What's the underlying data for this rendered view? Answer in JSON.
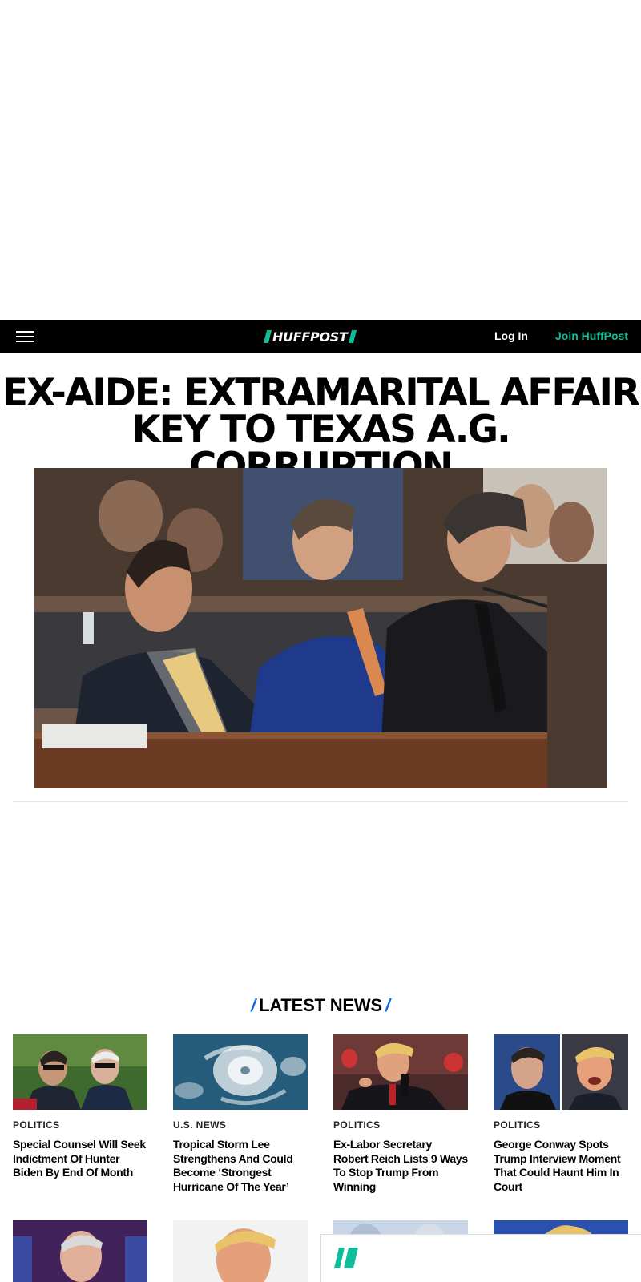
{
  "nav": {
    "logo_text": "HUFFPOST",
    "login_label": "Log In",
    "join_label": "Join HuffPost",
    "accent_color": "#0dbe98"
  },
  "hero": {
    "headline_line1": "EX-AIDE: EXTRAMARITAL AFFAIR",
    "headline_line2": "KEY TO TEXAS A.G. CORRUPTION"
  },
  "latest": {
    "title": "LATEST NEWS",
    "slash": "/",
    "accent_color": "#0c6cdd",
    "cards": [
      {
        "category": "POLITICS",
        "title": "Special Counsel Will Seek Indictment Of Hunter Biden By End Of Month"
      },
      {
        "category": "U.S. NEWS",
        "title": "Tropical Storm Lee Strengthens And Could Become ‘Strongest Hurricane Of The Year’"
      },
      {
        "category": "POLITICS",
        "title": "Ex-Labor Secretary Robert Reich Lists 9 Ways To Stop Trump From Winning"
      },
      {
        "category": "POLITICS",
        "title": "George Conway Spots Trump Interview Moment That Could Haunt Him In Court"
      }
    ]
  },
  "icons": {
    "menu": "hamburger-menu-icon",
    "banner_logo": "huffpost-mark-icon"
  }
}
